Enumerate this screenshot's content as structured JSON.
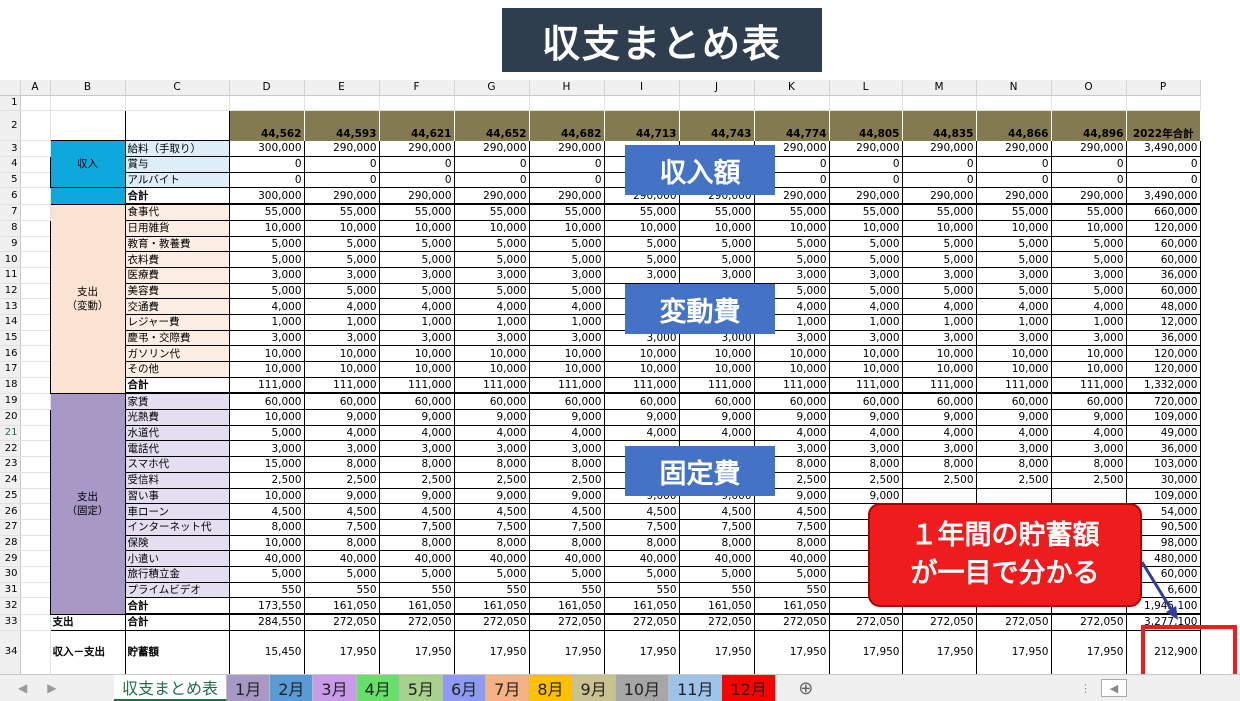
{
  "title": "収支まとめ表",
  "col_headers": [
    "A",
    "B",
    "C",
    "D",
    "E",
    "F",
    "G",
    "H",
    "I",
    "J",
    "K",
    "L",
    "M",
    "N",
    "O",
    "P"
  ],
  "row_numbers": [
    "1",
    "2",
    "3",
    "4",
    "5",
    "6",
    "7",
    "8",
    "9",
    "10",
    "11",
    "12",
    "13",
    "14",
    "15",
    "16",
    "17",
    "18",
    "19",
    "20",
    "21",
    "22",
    "23",
    "24",
    "25",
    "26",
    "27",
    "28",
    "29",
    "30",
    "31",
    "32",
    "33",
    "34"
  ],
  "months": [
    "44,562",
    "44,593",
    "44,621",
    "44,652",
    "44,682",
    "44,713",
    "44,743",
    "44,774",
    "44,805",
    "44,835",
    "44,866",
    "44,896"
  ],
  "total_header": "2022年合計",
  "categories": {
    "income": "収入",
    "variable": "支出\n（変動）",
    "fixed": "支出\n（固定）"
  },
  "income_rows": [
    {
      "item": "給料（手取り）",
      "values": [
        "300,000",
        "290,000",
        "290,000",
        "290,000",
        "290,000",
        "",
        "",
        "290,000",
        "290,000",
        "290,000",
        "290,000",
        "290,000"
      ],
      "total": "3,490,000"
    },
    {
      "item": "賞与",
      "values": [
        "0",
        "0",
        "0",
        "0",
        "0",
        "",
        "",
        "0",
        "0",
        "0",
        "0",
        "0"
      ],
      "total": "0"
    },
    {
      "item": "アルバイト",
      "values": [
        "0",
        "0",
        "0",
        "0",
        "0",
        "",
        "",
        "0",
        "0",
        "0",
        "0",
        "0"
      ],
      "total": "0"
    }
  ],
  "income_total": {
    "item": "合計",
    "values": [
      "300,000",
      "290,000",
      "290,000",
      "290,000",
      "290,000",
      "290,000",
      "290,000",
      "290,000",
      "290,000",
      "290,000",
      "290,000",
      "290,000"
    ],
    "total": "3,490,000"
  },
  "variable_rows": [
    {
      "item": "食事代",
      "values": [
        "55,000",
        "55,000",
        "55,000",
        "55,000",
        "55,000",
        "55,000",
        "55,000",
        "55,000",
        "55,000",
        "55,000",
        "55,000",
        "55,000"
      ],
      "total": "660,000"
    },
    {
      "item": "日用雑貨",
      "values": [
        "10,000",
        "10,000",
        "10,000",
        "10,000",
        "10,000",
        "10,000",
        "10,000",
        "10,000",
        "10,000",
        "10,000",
        "10,000",
        "10,000"
      ],
      "total": "120,000"
    },
    {
      "item": "教育・教養費",
      "values": [
        "5,000",
        "5,000",
        "5,000",
        "5,000",
        "5,000",
        "5,000",
        "5,000",
        "5,000",
        "5,000",
        "5,000",
        "5,000",
        "5,000"
      ],
      "total": "60,000"
    },
    {
      "item": "衣料費",
      "values": [
        "5,000",
        "5,000",
        "5,000",
        "5,000",
        "5,000",
        "5,000",
        "5,000",
        "5,000",
        "5,000",
        "5,000",
        "5,000",
        "5,000"
      ],
      "total": "60,000"
    },
    {
      "item": "医療費",
      "values": [
        "3,000",
        "3,000",
        "3,000",
        "3,000",
        "3,000",
        "3,000",
        "3,000",
        "3,000",
        "3,000",
        "3,000",
        "3,000",
        "3,000"
      ],
      "total": "36,000"
    },
    {
      "item": "美容費",
      "values": [
        "5,000",
        "5,000",
        "5,000",
        "5,000",
        "5,000",
        "",
        "",
        "5,000",
        "5,000",
        "5,000",
        "5,000",
        "5,000"
      ],
      "total": "60,000"
    },
    {
      "item": "交通費",
      "values": [
        "4,000",
        "4,000",
        "4,000",
        "4,000",
        "4,000",
        "",
        "",
        "4,000",
        "4,000",
        "4,000",
        "4,000",
        "4,000"
      ],
      "total": "48,000"
    },
    {
      "item": "レジャー費",
      "values": [
        "1,000",
        "1,000",
        "1,000",
        "1,000",
        "1,000",
        "",
        "",
        "1,000",
        "1,000",
        "1,000",
        "1,000",
        "1,000"
      ],
      "total": "12,000"
    },
    {
      "item": "慶弔・交際費",
      "values": [
        "3,000",
        "3,000",
        "3,000",
        "3,000",
        "3,000",
        "3,000",
        "3,000",
        "3,000",
        "3,000",
        "3,000",
        "3,000",
        "3,000"
      ],
      "total": "36,000"
    },
    {
      "item": "ガソリン代",
      "values": [
        "10,000",
        "10,000",
        "10,000",
        "10,000",
        "10,000",
        "10,000",
        "10,000",
        "10,000",
        "10,000",
        "10,000",
        "10,000",
        "10,000"
      ],
      "total": "120,000"
    },
    {
      "item": "その他",
      "values": [
        "10,000",
        "10,000",
        "10,000",
        "10,000",
        "10,000",
        "10,000",
        "10,000",
        "10,000",
        "10,000",
        "10,000",
        "10,000",
        "10,000"
      ],
      "total": "120,000"
    }
  ],
  "variable_total": {
    "item": "合計",
    "values": [
      "111,000",
      "111,000",
      "111,000",
      "111,000",
      "111,000",
      "111,000",
      "111,000",
      "111,000",
      "111,000",
      "111,000",
      "111,000",
      "111,000"
    ],
    "total": "1,332,000"
  },
  "fixed_rows": [
    {
      "item": "家賃",
      "values": [
        "60,000",
        "60,000",
        "60,000",
        "60,000",
        "60,000",
        "60,000",
        "60,000",
        "60,000",
        "60,000",
        "60,000",
        "60,000",
        "60,000"
      ],
      "total": "720,000"
    },
    {
      "item": "光熱費",
      "values": [
        "10,000",
        "9,000",
        "9,000",
        "9,000",
        "9,000",
        "9,000",
        "9,000",
        "9,000",
        "9,000",
        "9,000",
        "9,000",
        "9,000"
      ],
      "total": "109,000"
    },
    {
      "item": "水道代",
      "values": [
        "5,000",
        "4,000",
        "4,000",
        "4,000",
        "4,000",
        "4,000",
        "4,000",
        "4,000",
        "4,000",
        "4,000",
        "4,000",
        "4,000"
      ],
      "total": "49,000"
    },
    {
      "item": "電話代",
      "values": [
        "3,000",
        "3,000",
        "3,000",
        "3,000",
        "3,000",
        "",
        "",
        "3,000",
        "3,000",
        "3,000",
        "3,000",
        "3,000"
      ],
      "total": "36,000"
    },
    {
      "item": "スマホ代",
      "values": [
        "15,000",
        "8,000",
        "8,000",
        "8,000",
        "8,000",
        "",
        "",
        "8,000",
        "8,000",
        "8,000",
        "8,000",
        "8,000"
      ],
      "total": "103,000"
    },
    {
      "item": "受信料",
      "values": [
        "2,500",
        "2,500",
        "2,500",
        "2,500",
        "2,500",
        "",
        "",
        "2,500",
        "2,500",
        "2,500",
        "2,500",
        "2,500"
      ],
      "total": "30,000"
    },
    {
      "item": "習い事",
      "values": [
        "10,000",
        "9,000",
        "9,000",
        "9,000",
        "9,000",
        "9,000",
        "9,000",
        "9,000",
        "9,000",
        "",
        "",
        ""
      ],
      "total": "109,000"
    },
    {
      "item": "車ローン",
      "values": [
        "4,500",
        "4,500",
        "4,500",
        "4,500",
        "4,500",
        "4,500",
        "4,500",
        "4,500",
        "",
        "",
        "",
        ""
      ],
      "total": "54,000"
    },
    {
      "item": "インターネット代",
      "values": [
        "8,000",
        "7,500",
        "7,500",
        "7,500",
        "7,500",
        "7,500",
        "7,500",
        "7,500",
        "",
        "",
        "",
        ""
      ],
      "total": "90,500"
    },
    {
      "item": "保険",
      "values": [
        "10,000",
        "8,000",
        "8,000",
        "8,000",
        "8,000",
        "8,000",
        "8,000",
        "8,000",
        "",
        "",
        "",
        ""
      ],
      "total": "98,000"
    },
    {
      "item": "小遣い",
      "values": [
        "40,000",
        "40,000",
        "40,000",
        "40,000",
        "40,000",
        "40,000",
        "40,000",
        "40,000",
        "",
        "",
        "",
        ""
      ],
      "total": "480,000"
    },
    {
      "item": "旅行積立金",
      "values": [
        "5,000",
        "5,000",
        "5,000",
        "5,000",
        "5,000",
        "5,000",
        "5,000",
        "5,000",
        "",
        "",
        "",
        ""
      ],
      "total": "60,000"
    },
    {
      "item": "プライムビデオ",
      "values": [
        "550",
        "550",
        "550",
        "550",
        "550",
        "550",
        "550",
        "550",
        "",
        "",
        "",
        ""
      ],
      "total": "6,600"
    }
  ],
  "fixed_total": {
    "item": "合計",
    "values": [
      "173,550",
      "161,050",
      "161,050",
      "161,050",
      "161,050",
      "161,050",
      "161,050",
      "161,050",
      "",
      "",
      "",
      ""
    ],
    "total": "1,945,100"
  },
  "expense_row": {
    "label": "支出",
    "item": "合計",
    "values": [
      "284,550",
      "272,050",
      "272,050",
      "272,050",
      "272,050",
      "272,050",
      "272,050",
      "272,050",
      "272,050",
      "272,050",
      "272,050",
      "272,050"
    ],
    "total": "3,277,100"
  },
  "savings_row": {
    "label": "収入－支出",
    "item": "貯蓄額",
    "values": [
      "15,450",
      "17,950",
      "17,950",
      "17,950",
      "17,950",
      "17,950",
      "17,950",
      "17,950",
      "17,950",
      "17,950",
      "17,950",
      "17,950"
    ],
    "total": "212,900"
  },
  "callouts": {
    "income": "収入額",
    "variable": "変動費",
    "fixed": "固定費"
  },
  "note_lines": [
    "１年間の貯蓄額",
    "が一目で分かる"
  ],
  "tabs": [
    {
      "label": "収支まとめ表",
      "color": "#ffffff"
    },
    {
      "label": "1月",
      "color": "#a898c6"
    },
    {
      "label": "2月",
      "color": "#5b9bd5"
    },
    {
      "label": "3月",
      "color": "#c79be8"
    },
    {
      "label": "4月",
      "color": "#66e06a"
    },
    {
      "label": "5月",
      "color": "#a9d18e"
    },
    {
      "label": "6月",
      "color": "#8e9bf0"
    },
    {
      "label": "7月",
      "color": "#f4b183"
    },
    {
      "label": "8月",
      "color": "#ffc000"
    },
    {
      "label": "9月",
      "color": "#c9c290"
    },
    {
      "label": "10月",
      "color": "#a6a6a6"
    },
    {
      "label": "11月",
      "color": "#9dc3e6"
    },
    {
      "label": "12月",
      "color": "#ff0000"
    }
  ],
  "add_sheet_glyph": "⊕"
}
